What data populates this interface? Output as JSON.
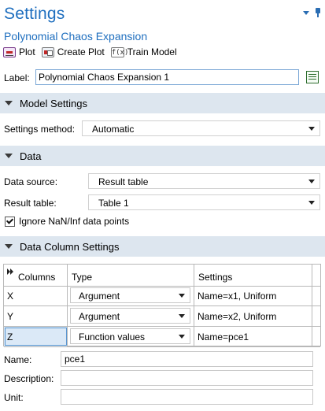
{
  "window": {
    "title": "Settings",
    "subtitle": "Polynomial Chaos Expansion"
  },
  "toolbar": {
    "plot_label": "Plot",
    "create_plot_label": "Create Plot",
    "train_model_label": "Train Model",
    "train_icon_text": "f(x)"
  },
  "label_field": {
    "label": "Label:",
    "value": "Polynomial Chaos Expansion 1"
  },
  "model_settings": {
    "title": "Model Settings",
    "settings_method_label": "Settings method:",
    "settings_method_value": "Automatic"
  },
  "data": {
    "title": "Data",
    "data_source_label": "Data source:",
    "data_source_value": "Result table",
    "result_table_label": "Result table:",
    "result_table_value": "Table 1",
    "ignore_nan_label": "Ignore NaN/Inf data points",
    "ignore_nan_checked": true
  },
  "data_column_settings": {
    "title": "Data Column Settings",
    "headers": [
      "Columns",
      "Type",
      "Settings"
    ],
    "rows": [
      {
        "column": "X",
        "type": "Argument",
        "settings": "Name=x1, Uniform"
      },
      {
        "column": "Y",
        "type": "Argument",
        "settings": "Name=x2, Uniform"
      },
      {
        "column": "Z",
        "type": "Function values",
        "settings": "Name=pce1"
      }
    ],
    "selected_row": 2
  },
  "column_fields": {
    "name_label": "Name:",
    "name_value": "pce1",
    "description_label": "Description:",
    "description_value": "",
    "unit_label": "Unit:",
    "unit_value": ""
  },
  "colors": {
    "title_blue": "#1f6fbf",
    "section_bg": "#dde6ef",
    "selected_cell": "#dbe9f7"
  }
}
